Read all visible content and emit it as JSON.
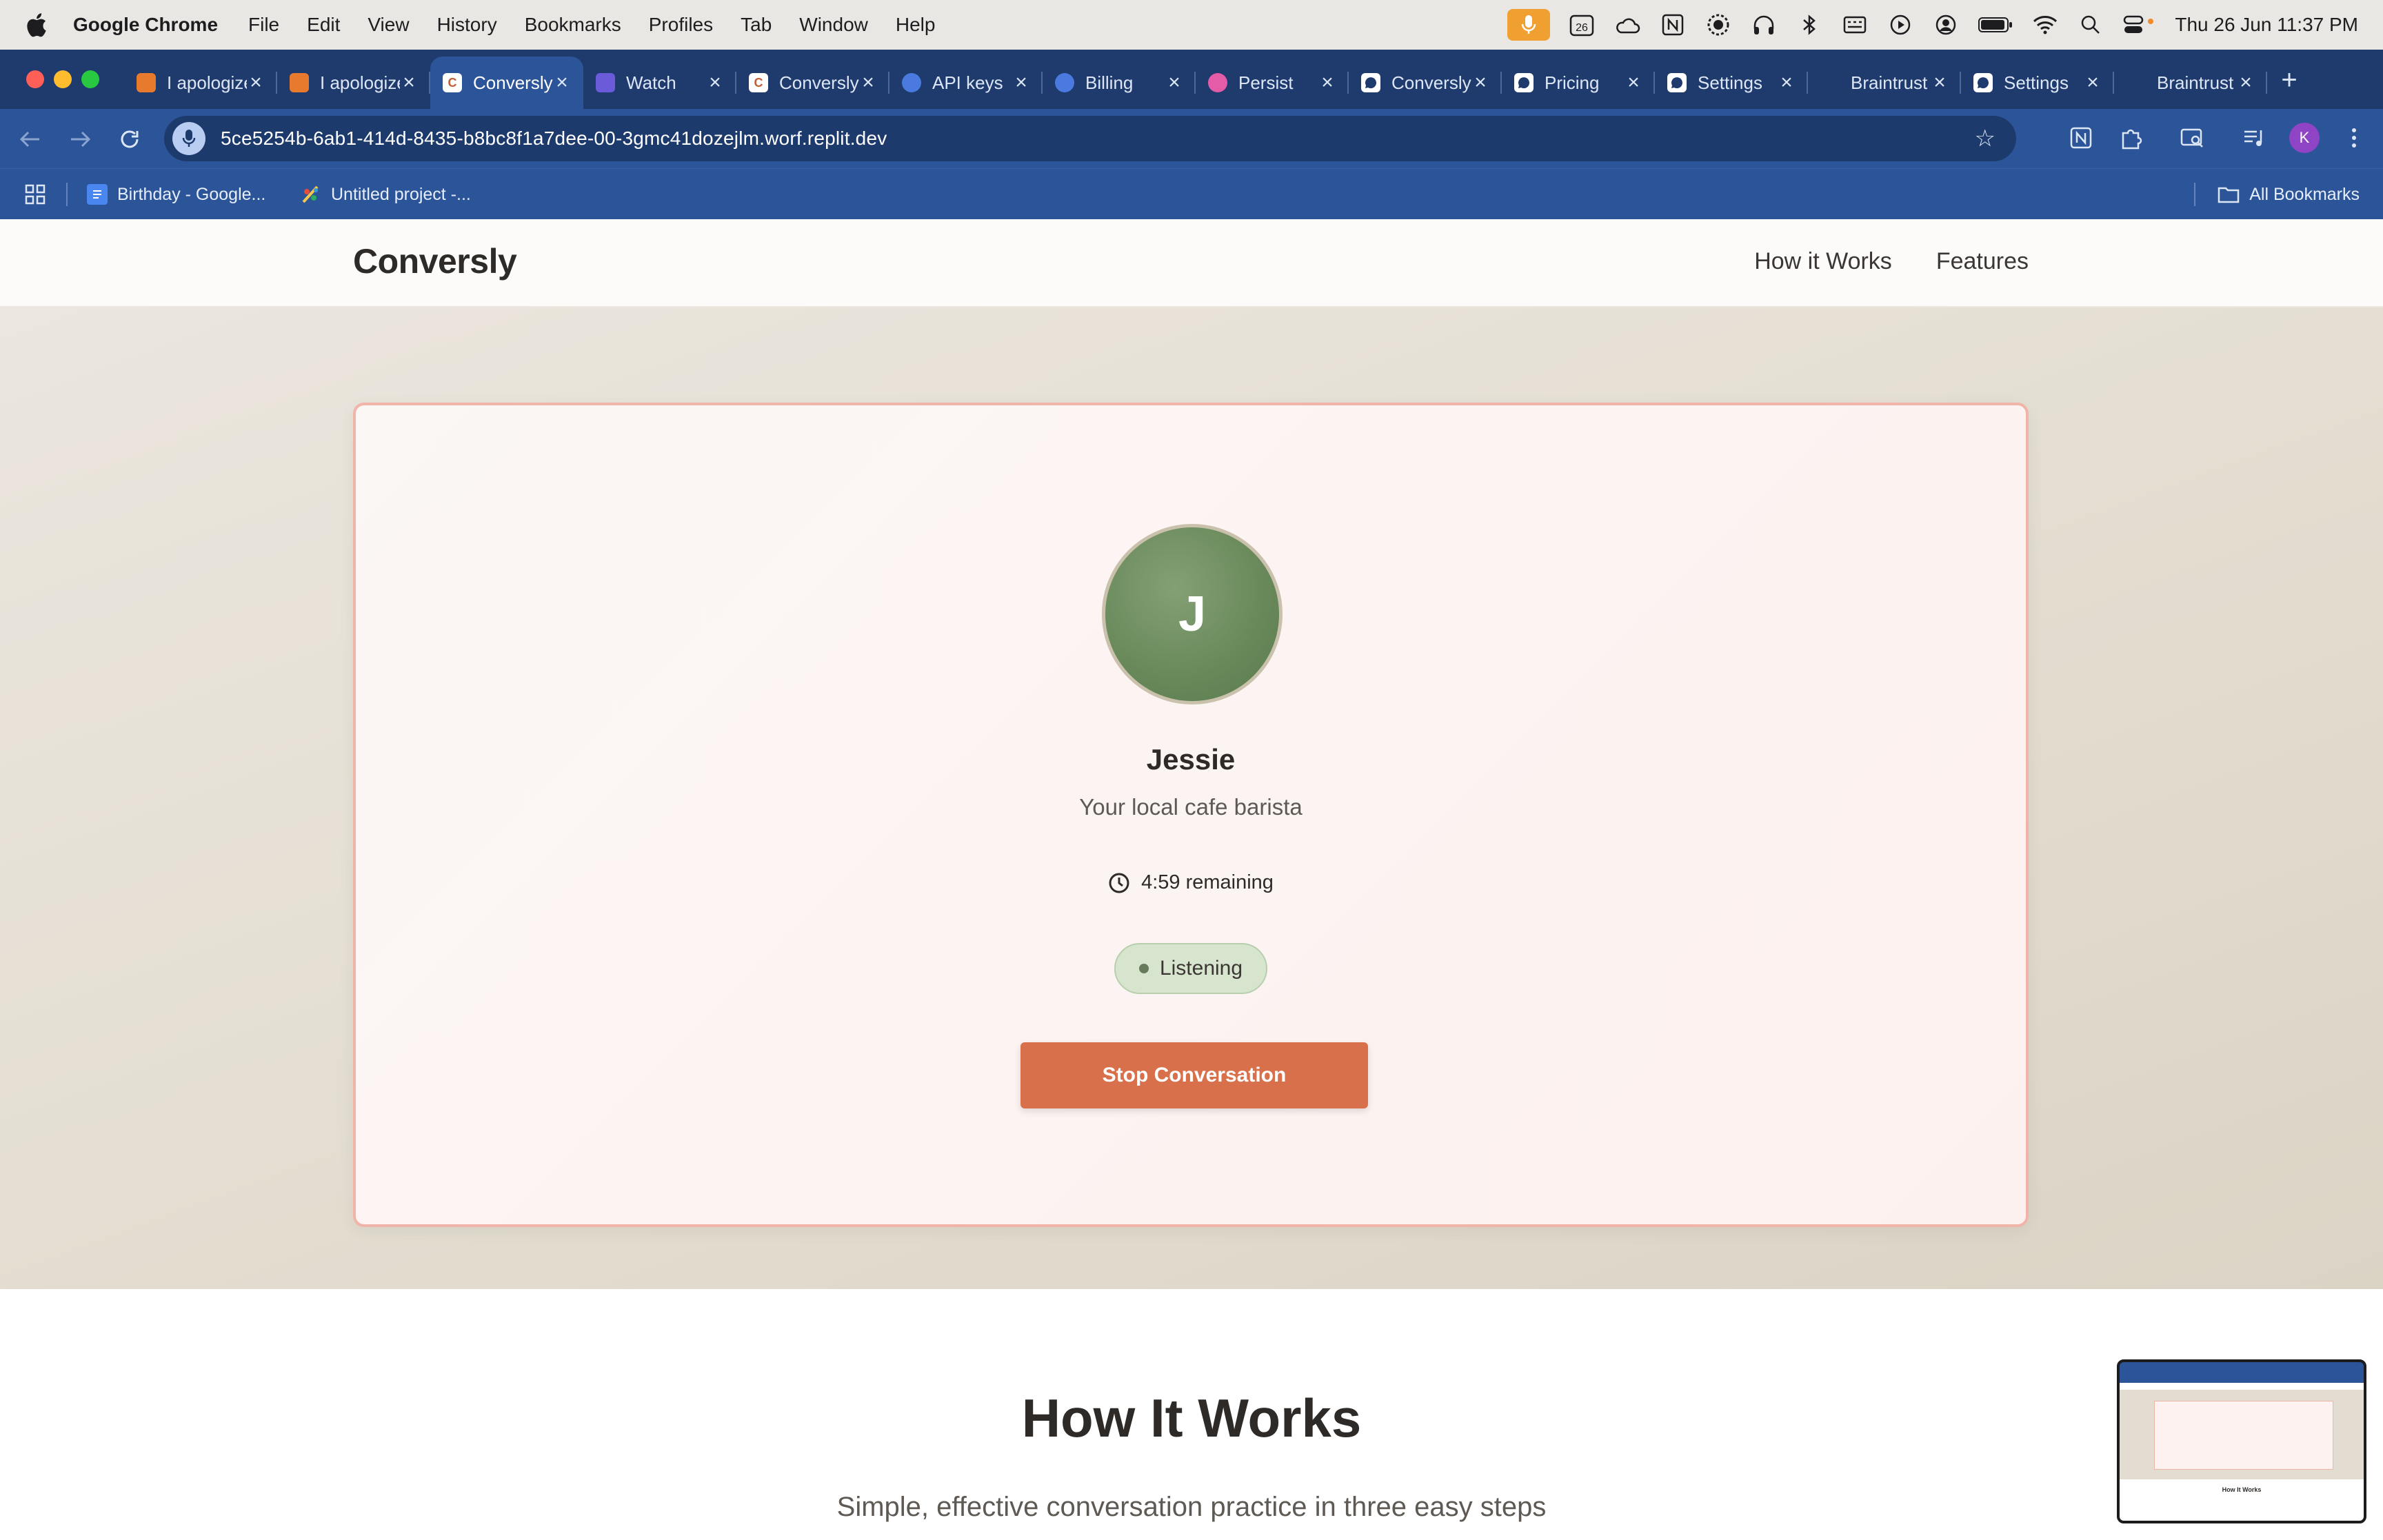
{
  "menubar": {
    "app_name": "Google Chrome",
    "items": [
      "File",
      "Edit",
      "View",
      "History",
      "Bookmarks",
      "Profiles",
      "Tab",
      "Window",
      "Help"
    ],
    "datetime": "Thu 26 Jun  11:37 PM",
    "calendar_day": "26"
  },
  "tabs": [
    {
      "title": "I apologize",
      "fav_color": "#e87a2e",
      "fav": "figma"
    },
    {
      "title": "I apologize",
      "fav_color": "#e87a2e",
      "fav": "figma"
    },
    {
      "title": "Conversly",
      "fav_color": "#ffffff",
      "fav_letter": "C",
      "active": true
    },
    {
      "title": "Watch",
      "fav_color": "#6b5bd8",
      "fav": "play"
    },
    {
      "title": "Conversly",
      "fav_color": "#ffffff",
      "fav_letter": "C"
    },
    {
      "title": "API keys",
      "fav_color": "#4a7ae0",
      "fav": "openai"
    },
    {
      "title": "Billing",
      "fav_color": "#4a7ae0",
      "fav": "openai"
    },
    {
      "title": "Persist",
      "fav_color": "#e45ca8",
      "fav": "openai"
    },
    {
      "title": "Conversly",
      "fav_color": "#ffffff",
      "fav": "chat"
    },
    {
      "title": "Pricing",
      "fav_color": "#ffffff",
      "fav": "chat"
    },
    {
      "title": "Settings",
      "fav_color": "#ffffff",
      "fav": "chat"
    },
    {
      "title": "Braintrust",
      "fav_color": "#1f3b6e",
      "fav": "none"
    },
    {
      "title": "Settings",
      "fav_color": "#ffffff",
      "fav": "chat"
    },
    {
      "title": "Braintrust",
      "fav_color": "#1f3b6e",
      "fav": "none"
    }
  ],
  "toolbar": {
    "url": "5ce5254b-6ab1-414d-8435-b8bc8f1a7dee-00-3gmc41dozejlm.worf.replit.dev",
    "profile_initial": "K"
  },
  "bookmarks": {
    "items": [
      {
        "label": "Birthday - Google...",
        "icon": "docs-icon"
      },
      {
        "label": "Untitled project -...",
        "icon": "palette-icon"
      }
    ],
    "all_bookmarks": "All Bookmarks"
  },
  "site": {
    "logo": "Conversly",
    "nav": [
      "How it Works",
      "Features"
    ]
  },
  "persona": {
    "initial": "J",
    "name": "Jessie",
    "description": "Your local cafe barista",
    "timer": "4:59 remaining",
    "status": "Listening",
    "stop_label": "Stop Conversation"
  },
  "how_it_works": {
    "title": "How It Works",
    "subtitle": "Simple, effective conversation practice in three easy steps"
  },
  "pip": {
    "caption": "How It Works"
  },
  "colors": {
    "accent": "#d9704c",
    "avatar": "#6a8a5c",
    "status_pill": "#d7e5cf",
    "chrome_frame": "#2c5498"
  }
}
